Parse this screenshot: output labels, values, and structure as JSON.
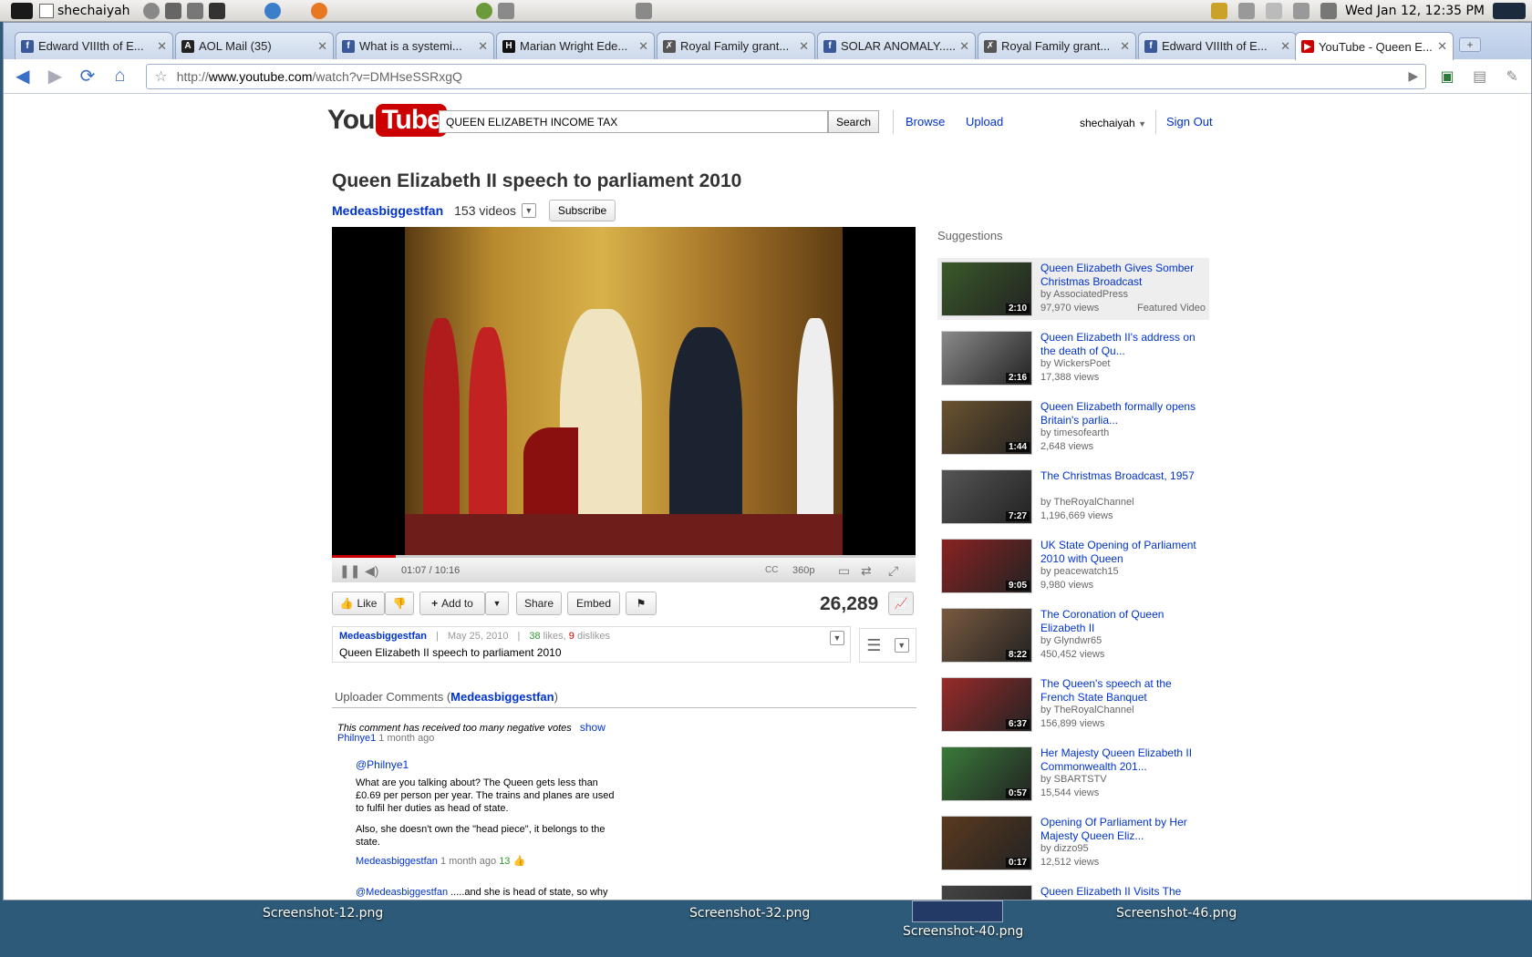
{
  "panel": {
    "username": "shechaiyah",
    "clock": "Wed Jan 12, 12:35 PM"
  },
  "tabs": [
    {
      "title": "Edward VIIIth of E...",
      "fav": "f",
      "color": "#3b5998"
    },
    {
      "title": "AOL Mail (35)",
      "fav": "A",
      "color": "#222"
    },
    {
      "title": "What is a systemi...",
      "fav": "f",
      "color": "#3b5998"
    },
    {
      "title": "Marian Wright Ede...",
      "fav": "H",
      "color": "#111"
    },
    {
      "title": "Royal Family grant...",
      "fav": "✗",
      "color": "#555"
    },
    {
      "title": "SOLAR ANOMALY.....",
      "fav": "f",
      "color": "#3b5998"
    },
    {
      "title": "Royal Family grant...",
      "fav": "✗",
      "color": "#555"
    },
    {
      "title": "Edward VIIIth of E...",
      "fav": "f",
      "color": "#3b5998"
    },
    {
      "title": "YouTube - Queen E...",
      "fav": "▶",
      "color": "#c00"
    }
  ],
  "address": {
    "prefix": "http://",
    "host": "www.youtube.com",
    "path": "/watch?v=DMHseSSRxgQ"
  },
  "header": {
    "logo_you": "You",
    "logo_tube": "Tube",
    "search_value": "QUEEN ELIZABETH INCOME TAX",
    "search_button": "Search",
    "browse": "Browse",
    "upload": "Upload",
    "user": "shechaiyah",
    "sign_out": "Sign Out"
  },
  "video": {
    "title": "Queen Elizabeth II speech to parliament 2010",
    "channel": "Medeasbiggestfan",
    "video_count": "153 videos",
    "subscribe": "Subscribe",
    "time": "01:07 / 10:16",
    "quality": "360p",
    "progress": 0.109,
    "views": "26,289"
  },
  "actions": {
    "like": "Like",
    "add_to": "Add to",
    "share": "Share",
    "embed": "Embed"
  },
  "info": {
    "uploader": "Medeasbiggestfan",
    "date": "May 25, 2010",
    "likes_num": "38",
    "likes_word": "likes,",
    "dislikes_num": "9",
    "dislikes_word": "dislikes",
    "description": "Queen Elizabeth II speech to parliament 2010"
  },
  "comments": {
    "heading_prefix": "Uploader Comments (",
    "heading_user": "Medeasbiggestfan",
    "heading_suffix": ")",
    "hidden_notice": "This comment has received too many negative votes",
    "show": "show",
    "c1_author": "Philnye1",
    "c1_ago": "1 month ago",
    "r1_mention": "@Philnye1",
    "r1_p1": "What are you talking about? The Queen gets less than £0.69 per person per year. The trains and planes are used to fulfil her duties as head of state.",
    "r1_p2": "Also, she doesn't own the \"head piece\", it belongs to the state.",
    "r1_author": "Medeasbiggestfan",
    "r1_ago": "1 month ago",
    "r1_votes": "13",
    "r2_mention": "@Medeasbiggestfan",
    "r2_text": " .....and she is head of state, so why doesn't she sell it to an oligarch and build a new school ?"
  },
  "suggestions": {
    "heading": "Suggestions",
    "items": [
      {
        "title": "Queen Elizabeth Gives Somber Christmas Broadcast",
        "by": "by AssociatedPress",
        "views": "97,970 views",
        "dur": "2:10",
        "featured": "Featured Video"
      },
      {
        "title": "Queen Elizabeth II's address on the death of Qu...",
        "by": "by WickersPoet",
        "views": "17,388 views",
        "dur": "2:16"
      },
      {
        "title": "Queen Elizabeth formally opens Britain's parlia...",
        "by": "by timesofearth",
        "views": "2,648 views",
        "dur": "1:44"
      },
      {
        "title": "The Christmas Broadcast, 1957",
        "by": "by TheRoyalChannel",
        "views": "1,196,669 views",
        "dur": "7:27"
      },
      {
        "title": "UK State Opening of Parliament 2010 with Queen",
        "by": "by peacewatch15",
        "views": "9,980 views",
        "dur": "9:05"
      },
      {
        "title": "The Coronation of Queen Elizabeth II",
        "by": "by Glyndwr65",
        "views": "450,452 views",
        "dur": "8:22"
      },
      {
        "title": "The Queen's speech at the French State Banquet",
        "by": "by TheRoyalChannel",
        "views": "156,899 views",
        "dur": "6:37"
      },
      {
        "title": "Her Majesty Queen Elizabeth II Commonwealth 201...",
        "by": "by SBARTSTV",
        "views": "15,544 views",
        "dur": "0:57"
      },
      {
        "title": "Opening Of Parliament by Her Majesty Queen Eliz...",
        "by": "by dizzo95",
        "views": "12,512 views",
        "dur": "0:17"
      },
      {
        "title": "Queen Elizabeth II Visits The United Nations",
        "by": "",
        "views": "",
        "dur": ""
      }
    ]
  },
  "desktop": [
    "Screenshot-12.png",
    "Screenshot-32.png",
    "Screenshot-40.png",
    "Screenshot-46.png"
  ],
  "colors": {
    "link": "#0033cc",
    "brand": "#cc0000",
    "likes": "#339933"
  }
}
